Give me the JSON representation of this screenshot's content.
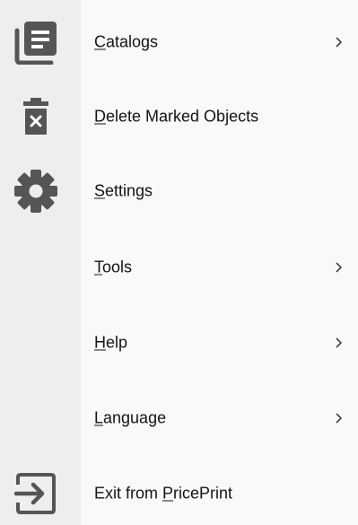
{
  "menu": {
    "items": [
      {
        "label": "Catalogs",
        "mnemonic": "C",
        "rest": "atalogs",
        "submenu": true,
        "icon": "catalogs-icon"
      },
      {
        "label": "Delete Marked Objects",
        "mnemonic": "D",
        "rest": "elete Marked Objects",
        "submenu": false,
        "icon": "delete-marked-icon"
      },
      {
        "label": "Settings",
        "mnemonic": "S",
        "rest": "ettings",
        "submenu": false,
        "icon": "gear-icon"
      },
      {
        "label": "Tools",
        "mnemonic": "T",
        "rest": "ools",
        "submenu": true,
        "icon": ""
      },
      {
        "label": "Help",
        "mnemonic": "H",
        "rest": "elp",
        "submenu": true,
        "icon": ""
      },
      {
        "label": "Language",
        "mnemonic": "L",
        "rest": "anguage",
        "submenu": true,
        "icon": ""
      },
      {
        "label": "Exit from PricePrint",
        "prefix": "Exit from ",
        "mnemonic": "P",
        "rest": "ricePrint",
        "submenu": false,
        "icon": "exit-icon"
      }
    ],
    "colors": {
      "icon": "#555555",
      "text": "#141414",
      "gutter": "#eeeeee",
      "background": "#f9f9f9"
    }
  }
}
